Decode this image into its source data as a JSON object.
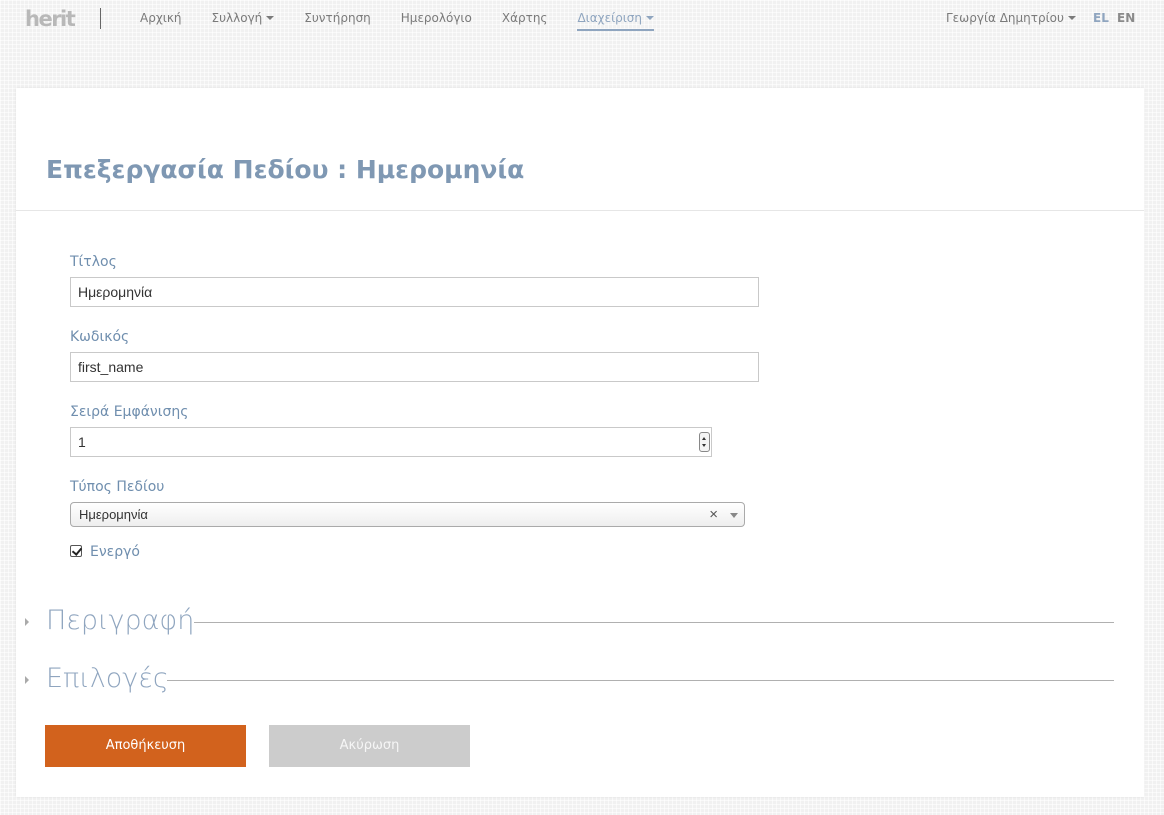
{
  "topbar": {
    "logo": "herit",
    "nav": [
      {
        "label": "Αρχική",
        "dropdown": false
      },
      {
        "label": "Συλλογή",
        "dropdown": true
      },
      {
        "label": "Συντήρηση",
        "dropdown": false
      },
      {
        "label": "Ημερολόγιο",
        "dropdown": false
      },
      {
        "label": "Χάρτης",
        "dropdown": false
      },
      {
        "label": "Διαχείριση",
        "dropdown": true,
        "active": true
      }
    ],
    "user": "Γεωργία Δημητρίου",
    "languages": [
      "EL",
      "EN"
    ],
    "active_language": "EL"
  },
  "page": {
    "title": "Επεξεργασία Πεδίου : Ημερομηνία"
  },
  "form": {
    "title_label": "Τίτλος",
    "title_value": "Ημερομηνία",
    "code_label": "Κωδικός",
    "code_value": "first_name",
    "order_label": "Σειρά Εμφάνισης",
    "order_value": "1",
    "type_label": "Τύπος Πεδίου",
    "type_value": "Ημερομηνία",
    "type_clear": "×",
    "active_label": "Ενεργό",
    "active_checked": true
  },
  "sections": {
    "description": "Περιγραφή",
    "options": "Επιλογές"
  },
  "buttons": {
    "save": "Αποθήκευση",
    "cancel": "Ακύρωση"
  },
  "colors": {
    "accent": "#8fa5bf",
    "label": "#6f8eae",
    "save_button": "#d2621d",
    "cancel_button": "#cccccc"
  }
}
